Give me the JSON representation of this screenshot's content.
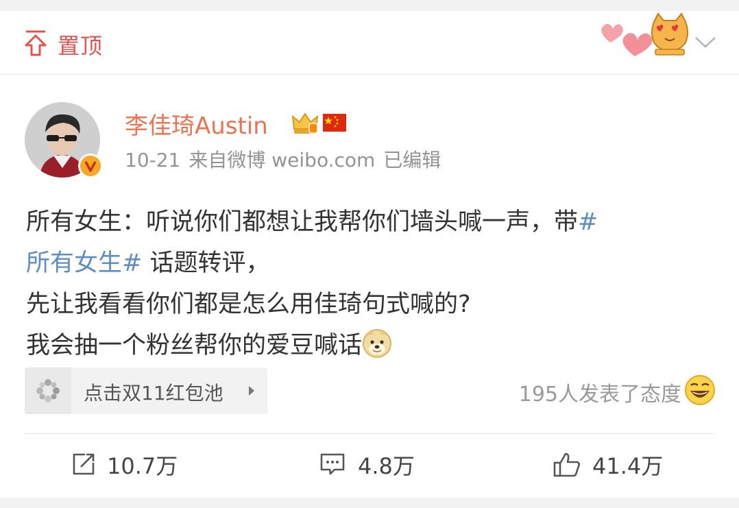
{
  "pinned": {
    "label": "置顶"
  },
  "author": {
    "name": "李佳琦Austin",
    "date": "10-21",
    "source": "来自微博 weibo.com",
    "edited": "已编辑"
  },
  "post": {
    "line1_text": "所有女生：听说你们都想让我帮你们墙头喊一声，带",
    "topic_hash_start": "#",
    "topic": "所有女生#",
    "line2_text": " 话题转评，",
    "line3": "先让我看看你们都是怎么用佳琦句式喊的?",
    "line4": "我会抽一个粉丝帮你的爱豆喊话"
  },
  "red_packet": {
    "label": "点击双11红包池"
  },
  "attitude": {
    "text": "195人发表了态度"
  },
  "actions": {
    "repost": "10.7万",
    "comment": "4.8万",
    "like": "41.4万"
  },
  "colors": {
    "accent": "#eb7350",
    "pin": "#e0534f",
    "topic": "#5e8dbf",
    "muted": "#939393"
  },
  "icons": [
    "pin-icon",
    "hearts-sticker-icon",
    "cat-sticker-icon",
    "chevron-down-icon",
    "crown-badge-icon",
    "china-flag-icon",
    "verified-icon",
    "doge-emoji-icon",
    "red-packet-icon",
    "caret-right-icon",
    "laugh-emoji-icon",
    "repost-icon",
    "comment-icon",
    "like-icon"
  ]
}
